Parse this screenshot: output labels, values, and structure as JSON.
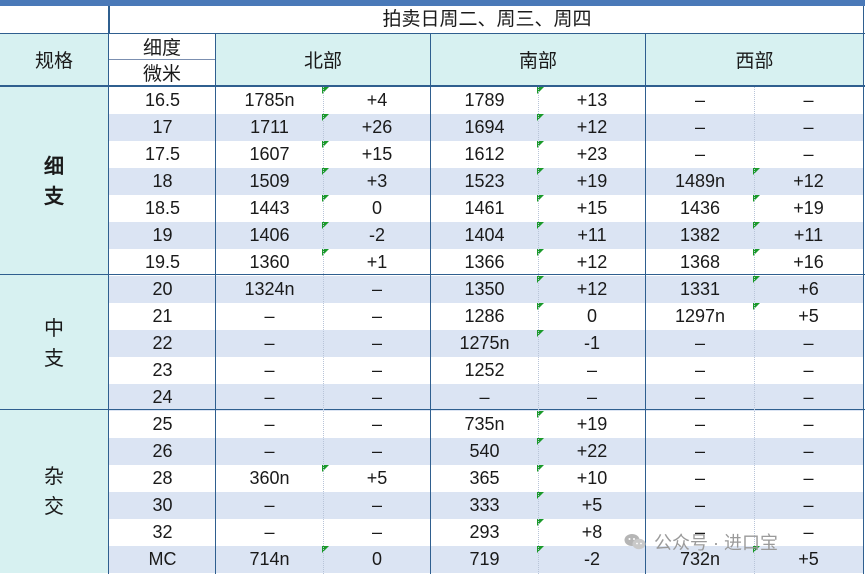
{
  "header": {
    "subtitle": "拍卖日周二、周三、周四",
    "spec_label": "规格",
    "fineness_label_1": "细度",
    "fineness_label_2": "微米",
    "north": "北部",
    "south": "南部",
    "west": "西部"
  },
  "groups": [
    {
      "chars": [
        "细",
        "支"
      ],
      "rows": 7
    },
    {
      "chars": [
        "中",
        "支"
      ],
      "rows": 5
    },
    {
      "chars": [
        "杂",
        "交"
      ],
      "rows": 6
    }
  ],
  "rows": [
    {
      "size": "16.5",
      "n1": "1785n",
      "n2": "+4",
      "s1": "1789",
      "s2": "+13",
      "w1": "–",
      "w2": "–",
      "fn": true,
      "fs": true,
      "fw": false
    },
    {
      "size": "17",
      "n1": "1711",
      "n2": "+26",
      "s1": "1694",
      "s2": "+12",
      "w1": "–",
      "w2": "–",
      "fn": true,
      "fs": true,
      "fw": false
    },
    {
      "size": "17.5",
      "n1": "1607",
      "n2": "+15",
      "s1": "1612",
      "s2": "+23",
      "w1": "–",
      "w2": "–",
      "fn": true,
      "fs": true,
      "fw": false
    },
    {
      "size": "18",
      "n1": "1509",
      "n2": "+3",
      "s1": "1523",
      "s2": "+19",
      "w1": "1489n",
      "w2": "+12",
      "fn": true,
      "fs": true,
      "fw": true
    },
    {
      "size": "18.5",
      "n1": "1443",
      "n2": "0",
      "s1": "1461",
      "s2": "+15",
      "w1": "1436",
      "w2": "+19",
      "fn": true,
      "fs": true,
      "fw": true
    },
    {
      "size": "19",
      "n1": "1406",
      "n2": "-2",
      "s1": "1404",
      "s2": "+11",
      "w1": "1382",
      "w2": "+11",
      "fn": true,
      "fs": true,
      "fw": true
    },
    {
      "size": "19.5",
      "n1": "1360",
      "n2": "+1",
      "s1": "1366",
      "s2": "+12",
      "w1": "1368",
      "w2": "+16",
      "fn": true,
      "fs": true,
      "fw": true
    },
    {
      "size": "20",
      "n1": "1324n",
      "n2": "–",
      "s1": "1350",
      "s2": "+12",
      "w1": "1331",
      "w2": "+6",
      "fn": false,
      "fs": true,
      "fw": true
    },
    {
      "size": "21",
      "n1": "–",
      "n2": "–",
      "s1": "1286",
      "s2": "0",
      "w1": "1297n",
      "w2": "+5",
      "fn": false,
      "fs": true,
      "fw": true
    },
    {
      "size": "22",
      "n1": "–",
      "n2": "–",
      "s1": "1275n",
      "s2": "-1",
      "w1": "–",
      "w2": "–",
      "fn": false,
      "fs": true,
      "fw": false
    },
    {
      "size": "23",
      "n1": "–",
      "n2": "–",
      "s1": "1252",
      "s2": "–",
      "w1": "–",
      "w2": "–",
      "fn": false,
      "fs": false,
      "fw": false
    },
    {
      "size": "24",
      "n1": "–",
      "n2": "–",
      "s1": "–",
      "s2": "–",
      "w1": "–",
      "w2": "–",
      "fn": false,
      "fs": false,
      "fw": false
    },
    {
      "size": "25",
      "n1": "–",
      "n2": "–",
      "s1": "735n",
      "s2": "+19",
      "w1": "–",
      "w2": "–",
      "fn": false,
      "fs": true,
      "fw": false
    },
    {
      "size": "26",
      "n1": "–",
      "n2": "–",
      "s1": "540",
      "s2": "+22",
      "w1": "–",
      "w2": "–",
      "fn": false,
      "fs": true,
      "fw": false
    },
    {
      "size": "28",
      "n1": "360n",
      "n2": "+5",
      "s1": "365",
      "s2": "+10",
      "w1": "–",
      "w2": "–",
      "fn": true,
      "fs": true,
      "fw": false
    },
    {
      "size": "30",
      "n1": "–",
      "n2": "–",
      "s1": "333",
      "s2": "+5",
      "w1": "–",
      "w2": "–",
      "fn": false,
      "fs": true,
      "fw": false
    },
    {
      "size": "32",
      "n1": "–",
      "n2": "–",
      "s1": "293",
      "s2": "+8",
      "w1": "–",
      "w2": "–",
      "fn": false,
      "fs": true,
      "fw": false
    },
    {
      "size": "MC",
      "n1": "714n",
      "n2": "0",
      "s1": "719",
      "s2": "-2",
      "w1": "732n",
      "w2": "+5",
      "fn": true,
      "fs": true,
      "fw": true
    }
  ],
  "watermark": {
    "icon": "wechat-icon",
    "text": "公众号 · 进口宝"
  }
}
